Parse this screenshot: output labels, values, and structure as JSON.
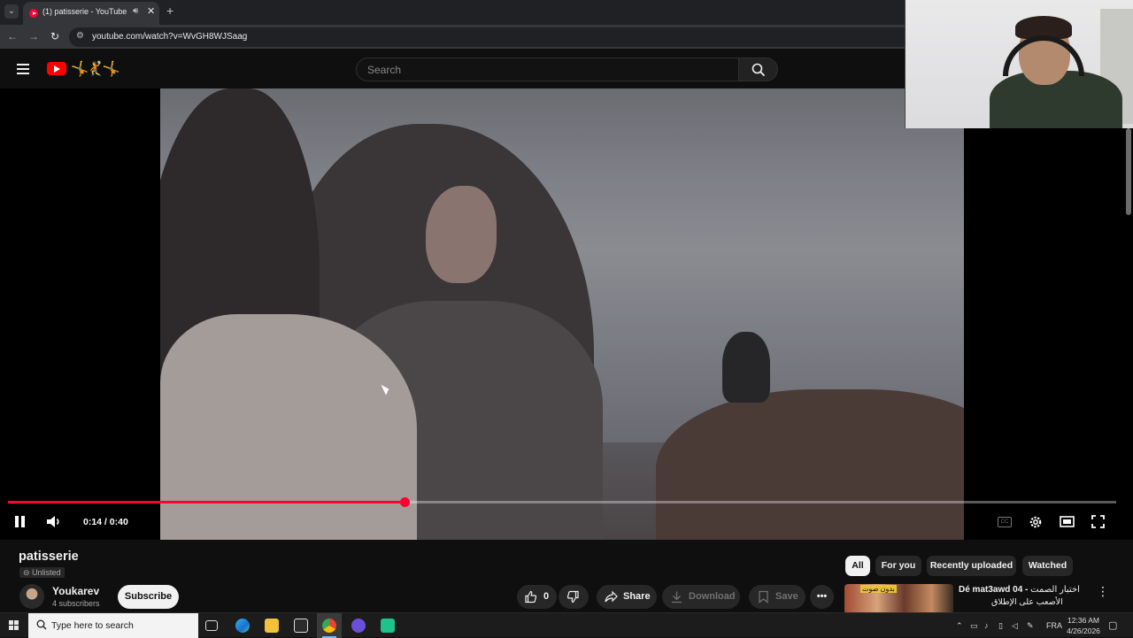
{
  "browser": {
    "tab_title": "(1) patisserie - YouTube",
    "url": "youtube.com/watch?v=WvGH8WJSaag"
  },
  "masthead": {
    "search_placeholder": "Search",
    "doodle": "🤸🤾🤸"
  },
  "player": {
    "time_display": "0:14 / 0:40",
    "progress": 0.358,
    "cc_label": "CC"
  },
  "video": {
    "title": "patisserie",
    "visibility": "Unlisted",
    "channel_name": "Youkarev",
    "subscribers": "4 subscribers",
    "subscribe_label": "Subscribe",
    "like_count": "0",
    "share_label": "Share",
    "download_label": "Download",
    "save_label": "Save"
  },
  "chips": [
    "All",
    "For you",
    "Recently uploaded",
    "Watched"
  ],
  "recommendation": {
    "badge": "بدون صوت",
    "title_latin": "Dé mat3awd 04 -",
    "title_arabic": "اختبار الصمت",
    "subtitle": "الأصعب على الإطلاق"
  },
  "taskbar": {
    "search_placeholder": "Type here to search",
    "language": "FRA",
    "time": "12:36 AM",
    "date": "4/26/2026"
  },
  "colors": {
    "youtube_red": "#ff0033",
    "background": "#0f0f0f",
    "pill": "#272727"
  }
}
